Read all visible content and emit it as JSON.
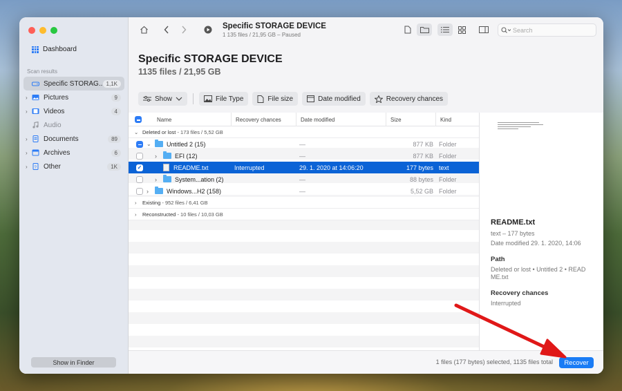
{
  "sidebar": {
    "dashboard": "Dashboard",
    "section": "Scan results",
    "items": [
      {
        "label": "Specific STORAG...",
        "count": "1,1K",
        "icon": "drive-icon"
      },
      {
        "label": "Pictures",
        "count": "9",
        "icon": "image-icon"
      },
      {
        "label": "Videos",
        "count": "4",
        "icon": "film-icon"
      },
      {
        "label": "Audio",
        "count": "",
        "icon": "music-icon"
      },
      {
        "label": "Documents",
        "count": "89",
        "icon": "document-icon"
      },
      {
        "label": "Archives",
        "count": "6",
        "icon": "archive-icon"
      },
      {
        "label": "Other",
        "count": "1K",
        "icon": "other-icon"
      }
    ],
    "finder": "Show in Finder"
  },
  "toolbar": {
    "title": "Specific STORAGE DEVICE",
    "subtitle": "1 135 files / 21,95 GB – Paused",
    "search_placeholder": "Search"
  },
  "header": {
    "title": "Specific STORAGE DEVICE",
    "subtitle": "1135 files / 21,95 GB"
  },
  "filters": {
    "show": "Show",
    "file_type": "File Type",
    "file_size": "File size",
    "date_modified": "Date modified",
    "recovery": "Recovery chances"
  },
  "table": {
    "columns": {
      "name": "Name",
      "recovery": "Recovery chances",
      "date": "Date modified",
      "size": "Size",
      "kind": "Kind"
    },
    "group1": {
      "name": "Deleted or lost",
      "meta": "- 173 files / 5,52 GB"
    },
    "rows": [
      {
        "name": "Untitled 2 (15)",
        "recovery": "",
        "date": "—",
        "size": "877 KB",
        "kind": "Folder"
      },
      {
        "name": "EFI (12)",
        "recovery": "",
        "date": "—",
        "size": "877 KB",
        "kind": "Folder"
      },
      {
        "name": "README.txt",
        "recovery": "Interrupted",
        "date": "29. 1. 2020 at 14:06:20",
        "size": "177 bytes",
        "kind": "text"
      },
      {
        "name": "System...ation (2)",
        "recovery": "",
        "date": "—",
        "size": "88 bytes",
        "kind": "Folder"
      },
      {
        "name": "Windows...H2 (158)",
        "recovery": "",
        "date": "—",
        "size": "5,52 GB",
        "kind": "Folder"
      }
    ],
    "group2": {
      "name": "Existing",
      "meta": "- 952 files / 6,41 GB"
    },
    "group3": {
      "name": "Reconstructed",
      "meta": "- 10 files / 10,03 GB"
    }
  },
  "preview": {
    "name": "README.txt",
    "type": "text – 177 bytes",
    "date": "Date modified 29. 1. 2020, 14:06",
    "path_label": "Path",
    "path": "Deleted or lost • Untitled 2 • READ",
    "path2": "ME.txt",
    "rec_label": "Recovery chances",
    "rec": "Interrupted"
  },
  "status": {
    "text": "1 files (177 bytes) selected, 1135 files total",
    "recover": "Recover"
  },
  "colors": {
    "accent": "#1a7cf5",
    "selection": "#0b63d6",
    "annotation_arrow": "#e01818"
  }
}
